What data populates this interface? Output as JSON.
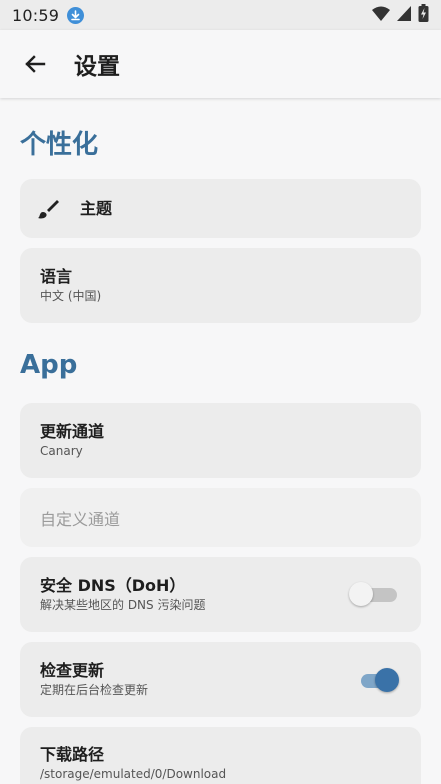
{
  "status_bar": {
    "time": "10:59"
  },
  "app_bar": {
    "title": "设置"
  },
  "sections": {
    "personalization": {
      "title": "个性化",
      "theme": {
        "label": "主题"
      },
      "language": {
        "title": "语言",
        "value": "中文 (中国)"
      }
    },
    "app": {
      "title": "App",
      "update_channel": {
        "title": "更新通道",
        "value": "Canary"
      },
      "custom_channel": {
        "title": "自定义通道"
      },
      "secure_dns": {
        "title": "安全 DNS（DoH）",
        "subtitle": "解决某些地区的 DNS 污染问题",
        "enabled": false
      },
      "check_update": {
        "title": "检查更新",
        "subtitle": "定期在后台检查更新",
        "enabled": true
      },
      "download_path": {
        "title": "下载路径",
        "value": "/storage/emulated/0/Download"
      }
    }
  },
  "icons": [
    "download-notification-icon",
    "wifi-icon",
    "cellular-signal-icon",
    "battery-charging-icon",
    "back-arrow-icon",
    "brush-icon"
  ],
  "colors": {
    "accent": "#3a6f9a",
    "toggle_on": "#3a72a8",
    "card_bg": "#ececec",
    "page_bg": "#f7f7f8"
  }
}
